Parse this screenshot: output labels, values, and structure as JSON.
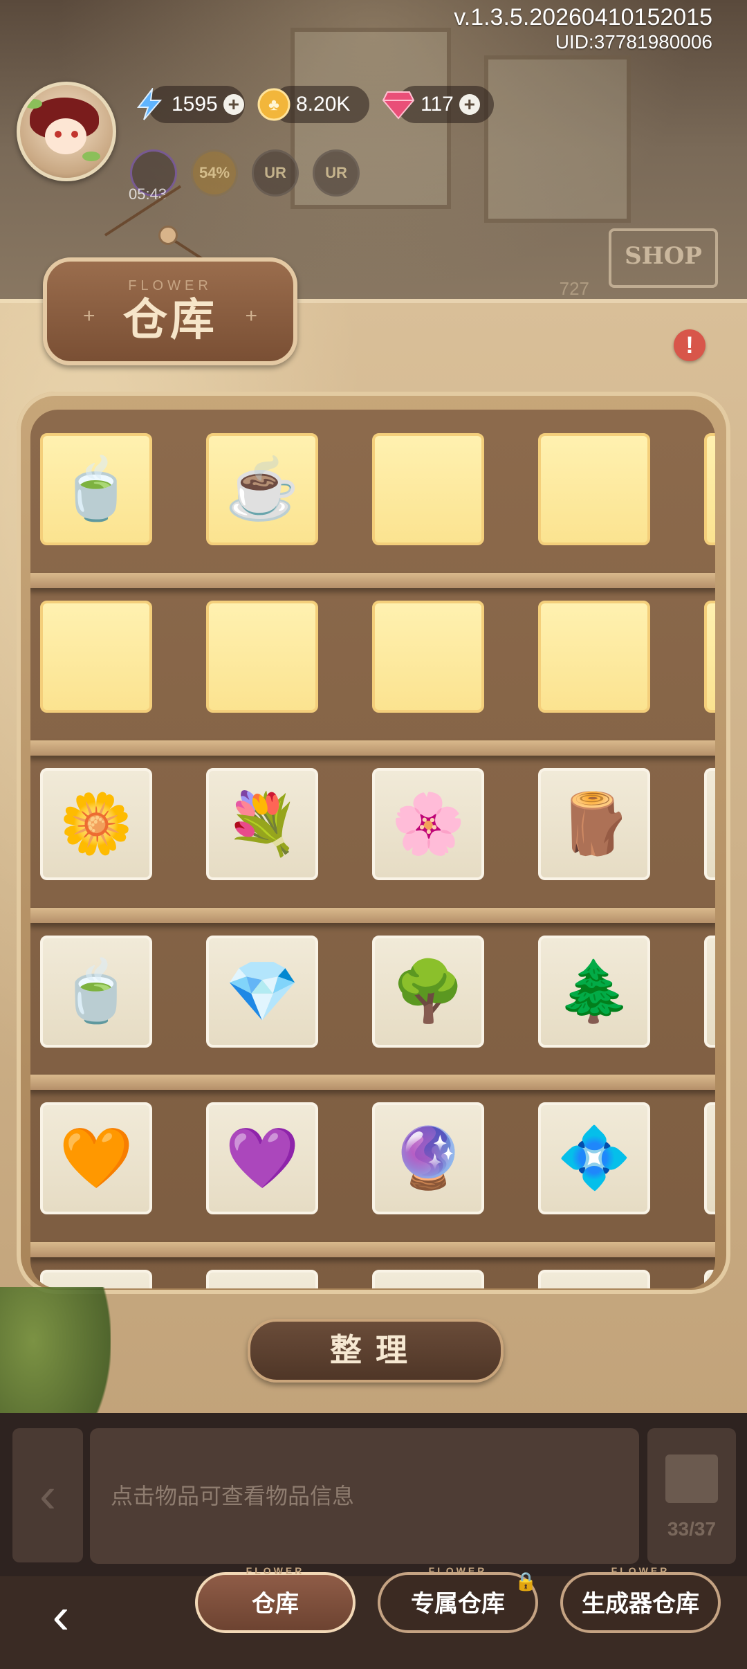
{
  "status": {
    "version": "v.1.3.5.20260410152015",
    "uid": "UID:37781980006"
  },
  "resources": {
    "energy": "1595",
    "coins": "8.20K",
    "gems": "117"
  },
  "mini_icons": {
    "progress": "54%",
    "ur1": "UR",
    "ur2": "UR",
    "timer": "05:43"
  },
  "scene": {
    "shop_sign": "SHOP",
    "faint_value": "727"
  },
  "panel": {
    "title": "仓库",
    "title_deco": "FLOWER",
    "sort_button": "整理"
  },
  "shelves": [
    {
      "items": [
        {
          "name": "cat-teacup-flower-item",
          "icon": "🍵",
          "kind": "item-gold"
        },
        {
          "name": "cat-purple-teacup-item",
          "icon": "☕",
          "kind": "item-gold"
        },
        {
          "name": "empty-slot",
          "icon": "",
          "kind": "empty"
        },
        {
          "name": "empty-slot",
          "icon": "",
          "kind": "empty"
        },
        {
          "name": "empty-slot",
          "icon": "",
          "kind": "empty"
        }
      ]
    },
    {
      "items": [
        {
          "name": "empty-slot",
          "icon": "",
          "kind": "empty"
        },
        {
          "name": "empty-slot",
          "icon": "",
          "kind": "empty"
        },
        {
          "name": "empty-slot",
          "icon": "",
          "kind": "empty"
        },
        {
          "name": "empty-slot",
          "icon": "",
          "kind": "empty"
        },
        {
          "name": "empty-slot",
          "icon": "",
          "kind": "empty"
        }
      ]
    },
    {
      "items": [
        {
          "name": "yellow-flower-frog-item",
          "icon": "🌼",
          "kind": "item"
        },
        {
          "name": "yellow-bouquet-item",
          "icon": "💐",
          "kind": "item"
        },
        {
          "name": "white-lily-item",
          "icon": "🌸",
          "kind": "item"
        },
        {
          "name": "clay-pot-item",
          "icon": "🪵",
          "kind": "item"
        },
        {
          "name": "cat-blue-teacup-item",
          "icon": "🫖",
          "kind": "item"
        }
      ]
    },
    {
      "items": [
        {
          "name": "cat-white-teacup-item",
          "icon": "🍵",
          "kind": "item"
        },
        {
          "name": "red-crystal-item",
          "icon": "💎",
          "kind": "item"
        },
        {
          "name": "glass-dome-pink-tree-item",
          "icon": "🌳",
          "kind": "item"
        },
        {
          "name": "glass-dome-blue-tree-item",
          "icon": "🌲",
          "kind": "item"
        },
        {
          "name": "water-drop-item",
          "icon": "💧",
          "kind": "item"
        }
      ]
    },
    {
      "items": [
        {
          "name": "orange-drop-item",
          "icon": "🧡",
          "kind": "item"
        },
        {
          "name": "purple-drop-item",
          "icon": "💜",
          "kind": "item"
        },
        {
          "name": "pink-crystal-item",
          "icon": "🔮",
          "kind": "item"
        },
        {
          "name": "purple-gem-item",
          "icon": "💠",
          "kind": "item"
        },
        {
          "name": "blue-feather-item",
          "icon": "🪶",
          "kind": "item"
        }
      ]
    },
    {
      "items": [
        {
          "name": "partial-item",
          "icon": "",
          "kind": "item"
        },
        {
          "name": "partial-item",
          "icon": "",
          "kind": "item"
        },
        {
          "name": "partial-item",
          "icon": "",
          "kind": "item"
        },
        {
          "name": "partial-item",
          "icon": "",
          "kind": "item"
        },
        {
          "name": "partial-item",
          "icon": "",
          "kind": "item"
        }
      ]
    }
  ],
  "info_bar": {
    "hint": "点击物品可查看物品信息",
    "box_count": "33/37"
  },
  "nav": {
    "tab1": "仓库",
    "tab2": "专属仓库",
    "tab3": "生成器仓库",
    "deco": "FLOWER"
  }
}
